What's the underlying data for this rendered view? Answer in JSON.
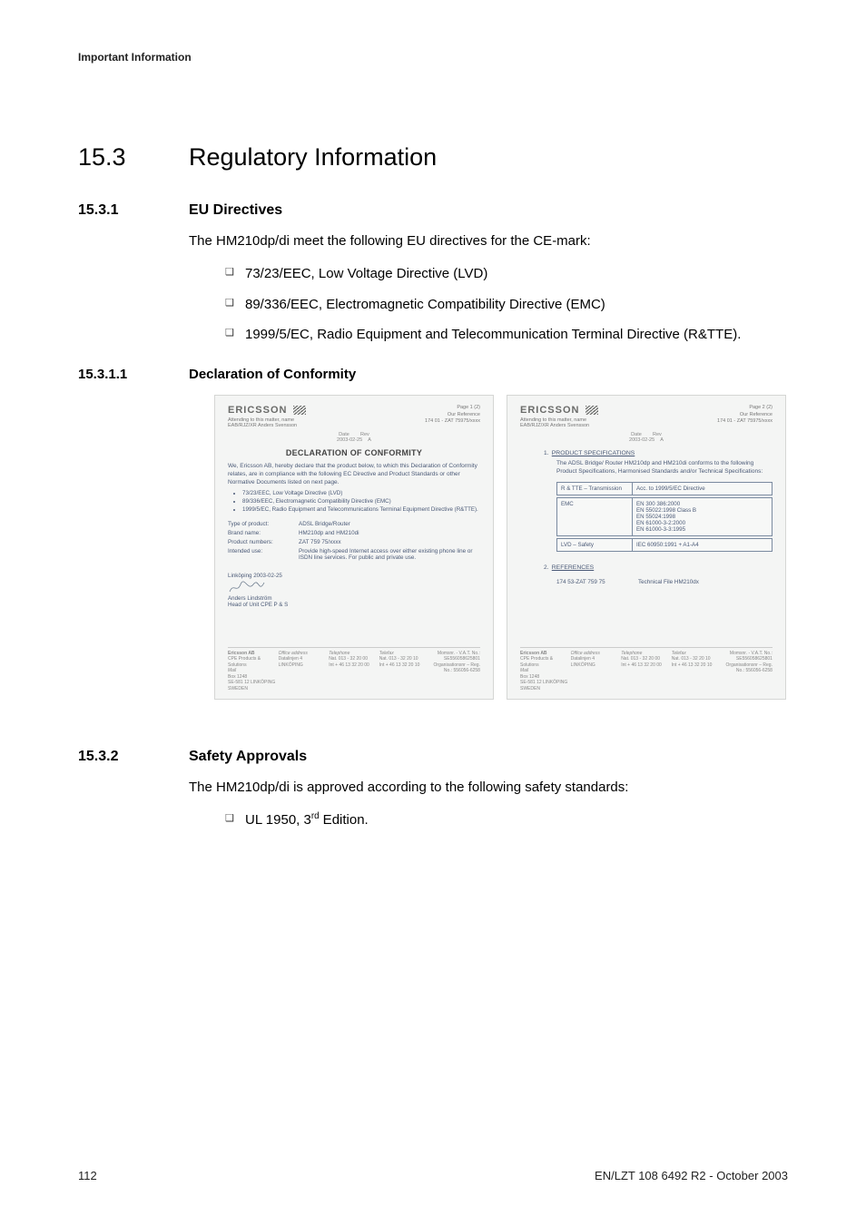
{
  "running_head": "Important Information",
  "h1": {
    "num": "15.3",
    "title": "Regulatory Information"
  },
  "s1": {
    "num": "15.3.1",
    "title": "EU Directives",
    "intro": "The HM210dp/di meet the following EU directives for the CE-mark:",
    "items": [
      "73/23/EEC, Low Voltage Directive (LVD)",
      "89/336/EEC, Electromagnetic Compatibility Directive (EMC)",
      "1999/5/EC, Radio Equipment and Telecommunication Terminal Directive (R&TTE)."
    ]
  },
  "s11": {
    "num": "15.3.1.1",
    "title": "Declaration of Conformity"
  },
  "doc_left": {
    "logo": "ERICSSON",
    "page": "Page   1 (2)",
    "ref_label": "Our Reference",
    "ref": "174 01 - ZAT 75975/xxxx",
    "date_label": "Date",
    "date": "2003-02-25",
    "rev_label": "Rev",
    "rev": "A",
    "attending_label": "Attending to this matter, name",
    "attending": "EAB/RJZ/XR Anders Svensson",
    "title": "DECLARATION OF CONFORMITY",
    "p1": "We, Ericsson AB, hereby declare that the product below, to which this Declaration of Conformity relates, are in compliance with the following EC Directive and Product Standards or other Normative Documents listed on next page.",
    "bullets": [
      "73/23/EEC, Low Voltage Directive (LVD)",
      "89/336/EEC, Electromagnetic Compatibility Directive (EMC)",
      "1999/5/EC, Radio Equipment and Telecommunications Terminal Equipment Directive (R&TTE)."
    ],
    "rows": [
      {
        "l": "Type of product:",
        "r": "ADSL Bridge/Router"
      },
      {
        "l": "Brand name:",
        "r": "HM210dp and HM210di"
      },
      {
        "l": "Product numbers:",
        "r": "ZAT 759 75/xxxx"
      },
      {
        "l": "Intended use:",
        "r": "Provide high-speed Internet access over either existing phone line or ISDN line services. For public and private use."
      }
    ],
    "sig_place": "Linköping 2003-02-25",
    "sig_name": "Anders Lindström",
    "sig_role": "Head of Unit CPE P & S",
    "footer": {
      "company": "Ericsson AB",
      "unit": "CPE Products & Solutions",
      "mail_label": "Mail",
      "mail": "Box 1248\nSE-581 12 LINKÖPING\nSWEDEN",
      "office_label": "Office address",
      "office": "Datalinjen 4\nLINKÖPING",
      "tel_label": "Telephone",
      "tel": "Nat. 013 - 32 20 00\nInt + 46 13 32 20 00",
      "fax_label": "Telefax",
      "fax": "Nat. 013 - 32 20 10\nInt + 46 13 32 20 10",
      "vat_label": "Momsnr. - V.A.T. No.: SE556058625801",
      "org_label": "Organisationsnr – Reg. No.: 556056-6258"
    }
  },
  "doc_right": {
    "logo": "ERICSSON",
    "page": "Page   2 (2)",
    "ref_label": "Our Reference",
    "ref": "174 01 - ZAT 75975/xxxx",
    "date_label": "Date",
    "date": "2003-02-25",
    "rev_label": "Rev",
    "rev": "A",
    "attending_label": "Attending to this matter, name",
    "attending": "EAB/RJZ/XR Anders Svensson",
    "sec1_num": "1.",
    "sec1_title": "PRODUCT SPECIFICATIONS",
    "sec1_p": "The ADSL Bridge/ Router HM210dp and HM210di conforms to the following Product Specifications, Harmonised Standards and/or Technical Specifications:",
    "table": [
      {
        "l": "R & TTE – Transmission",
        "r": "Acc. to 1999/5/EC Directive"
      },
      {
        "l": "EMC",
        "r": "EN 300 386:2000\nEN 55022:1998 Class B\nEN 55024:1998\nEN 61000-3-2:2000\nEN 61000-3-3:1995"
      },
      {
        "l": "LVD – Safety",
        "r": "IEC 60950:1991 + A1-A4"
      }
    ],
    "sec2_num": "2.",
    "sec2_title": "REFERENCES",
    "ref_l": "174 53-ZAT 759 75",
    "ref_r": "Technical File HM210dx",
    "footer": {
      "company": "Ericsson AB",
      "unit": "CPE Products & Solutions",
      "mail_label": "Mail",
      "mail": "Box 1248\nSE-581 12 LINKÖPING\nSWEDEN",
      "office_label": "Office address",
      "office": "Datalinjen 4\nLINKÖPING",
      "tel_label": "Telephone",
      "tel": "Nat. 013 - 32 20 00\nInt + 46 13 32 20 00",
      "fax_label": "Telefax",
      "fax": "Nat. 013 - 32 20 10\nInt + 46 13 32 20 10",
      "vat_label": "Momsnr. - V.A.T. No.: SE556058625801",
      "org_label": "Organisationsnr – Reg. No.: 556056-6258"
    }
  },
  "s2": {
    "num": "15.3.2",
    "title": "Safety Approvals",
    "intro": "The HM210dp/di is approved according to the following safety standards:",
    "items": [
      "UL 1950, 3rd Edition."
    ]
  },
  "footer": {
    "page": "112",
    "doc_id": "EN/LZT 108 6492 R2 - October 2003"
  }
}
